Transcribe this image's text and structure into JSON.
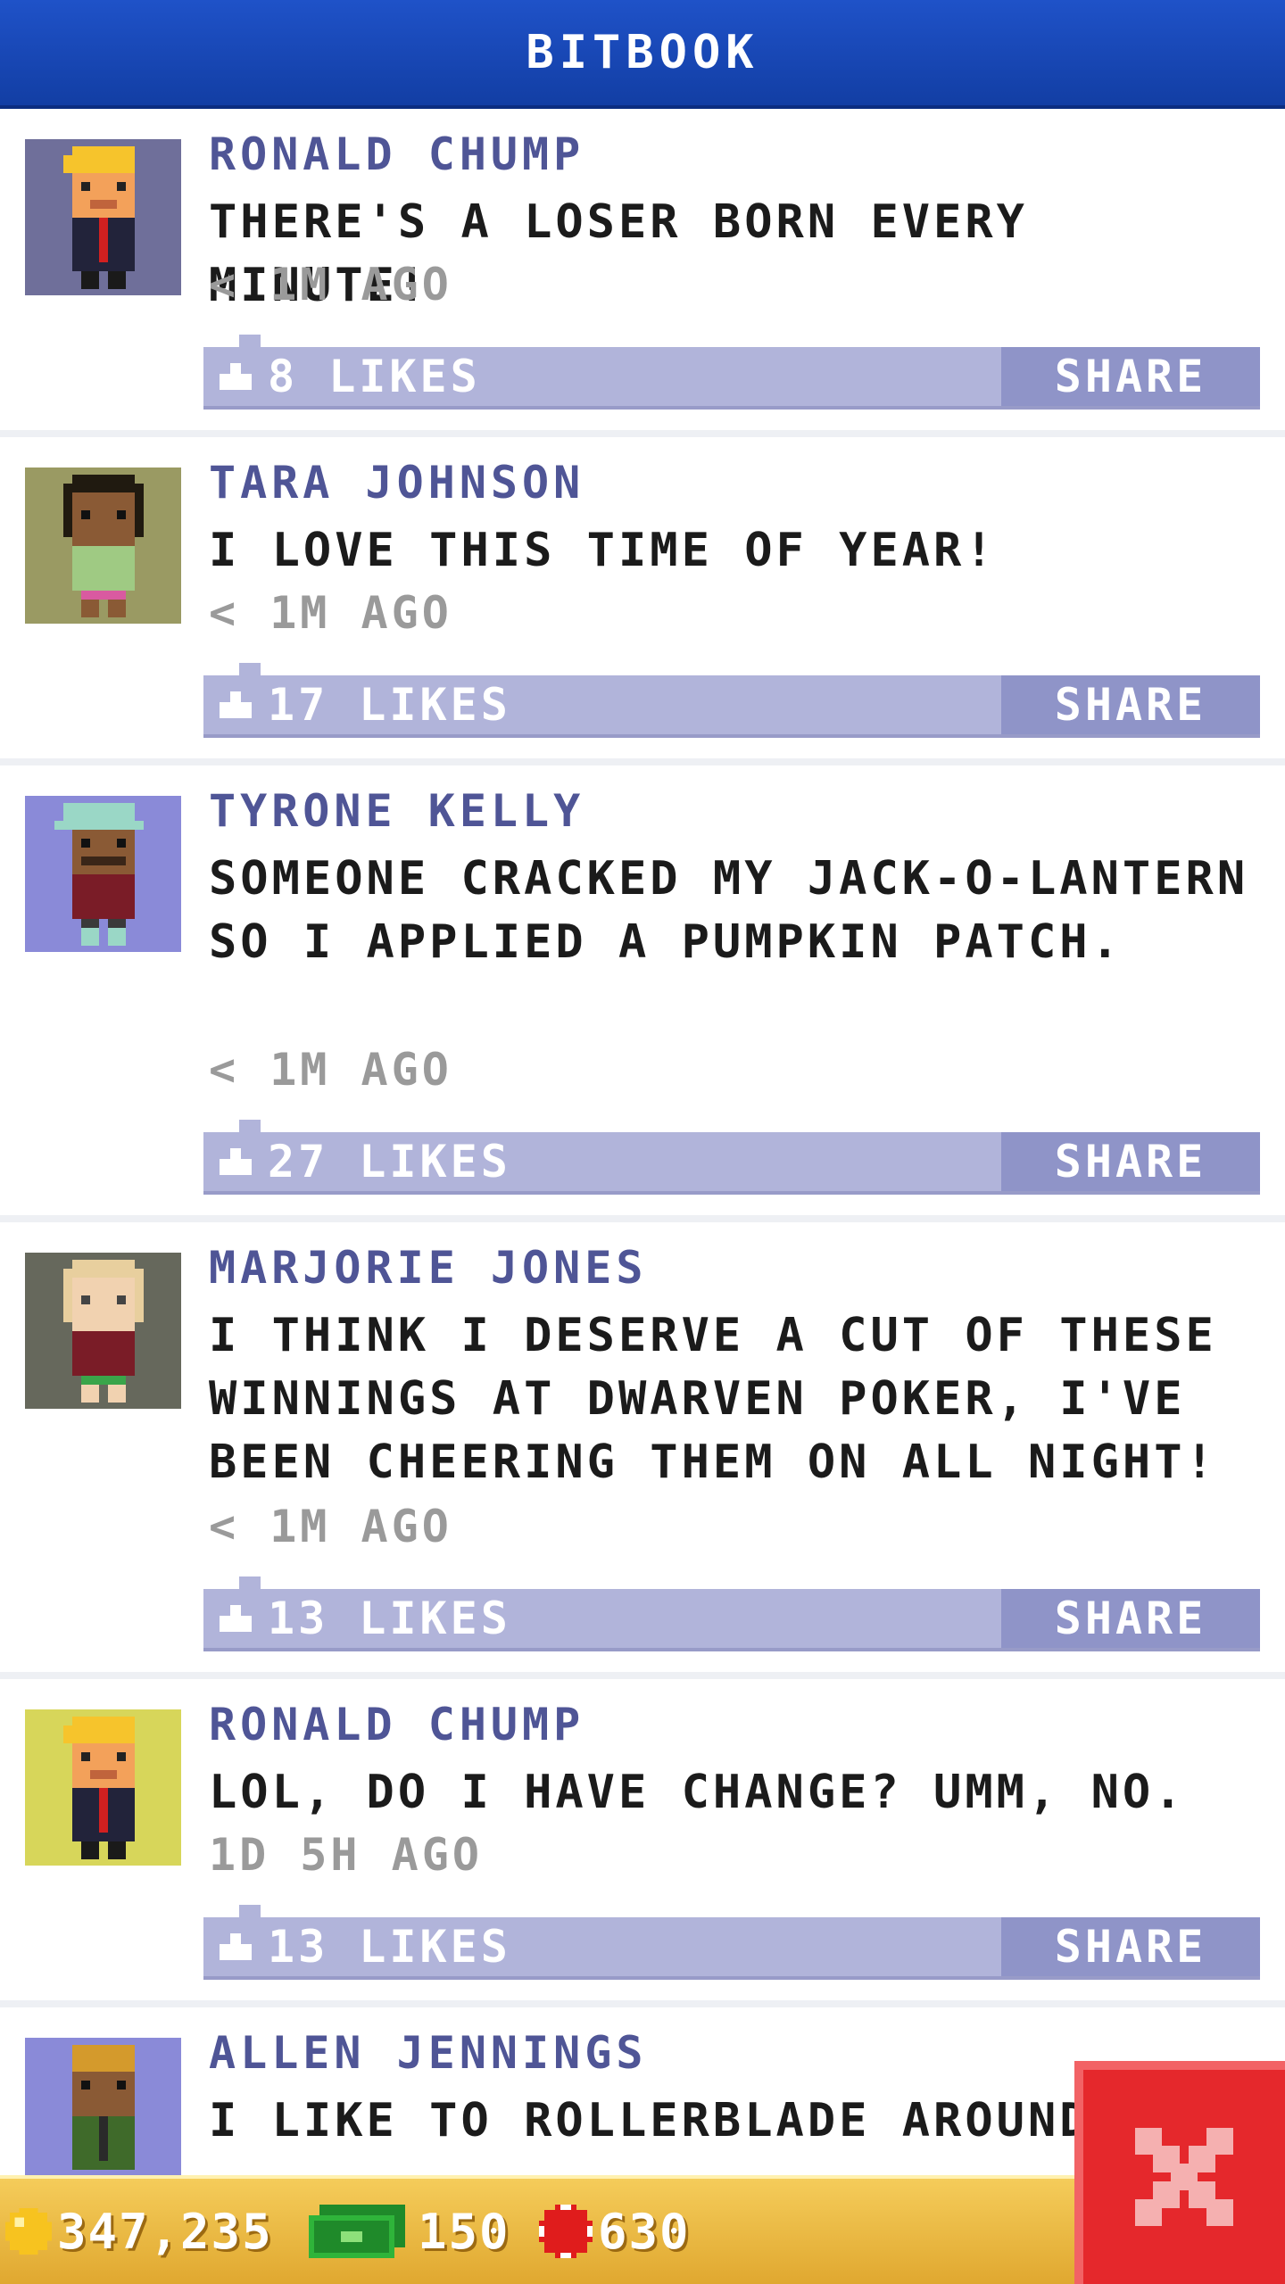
{
  "header": {
    "title": "BITBOOK"
  },
  "posts": [
    {
      "author": "RONALD CHUMP",
      "message": "THERE'S A LOSER BORN EVERY MINUTE!",
      "time": "< 1M AGO",
      "likes": "8 LIKES",
      "share": "SHARE",
      "avatar": {
        "icon": "ronald-chump-avatar",
        "bg": "#6f6f9a",
        "hair": "#f6c42c",
        "skin": "#f3a15a",
        "shirt": "#22233a",
        "accent": "#d22020"
      }
    },
    {
      "author": "TARA JOHNSON",
      "message": "I LOVE THIS TIME OF YEAR!",
      "time": "< 1M AGO",
      "likes": "17 LIKES",
      "share": "SHARE",
      "avatar": {
        "icon": "tara-johnson-avatar",
        "bg": "#9a9a63",
        "hair": "#201a10",
        "skin": "#8a5a35",
        "shirt": "#9fca83",
        "accent": "#d95aa0"
      }
    },
    {
      "author": "TYRONE KELLY",
      "message": "SOMEONE CRACKED MY JACK-O-LANTERN SO I APPLIED A PUMPKIN PATCH.",
      "time": "< 1M AGO",
      "likes": "27 LIKES",
      "share": "SHARE",
      "avatar": {
        "icon": "tyrone-kelly-avatar",
        "bg": "#8a8ad8",
        "hair": "#9ad7c6",
        "skin": "#8a5a35",
        "shirt": "#7a1c27",
        "accent": "#3a2618"
      }
    },
    {
      "author": "MARJORIE JONES",
      "message": "I THINK I DESERVE A CUT OF THESE WINNINGS AT DWARVEN POKER, I'VE BEEN CHEERING THEM ON ALL NIGHT!",
      "time": "< 1M AGO",
      "likes": "13 LIKES",
      "share": "SHARE",
      "avatar": {
        "icon": "marjorie-jones-avatar",
        "bg": "#66685c",
        "hair": "#e8cf9e",
        "skin": "#f1d2b0",
        "shirt": "#7a1c27",
        "accent": "#3aa54a"
      }
    },
    {
      "author": "RONALD CHUMP",
      "message": "LOL, DO I HAVE CHANGE? UMM, NO.",
      "time": "1D 5H AGO",
      "likes": "13 LIKES",
      "share": "SHARE",
      "avatar": {
        "icon": "ronald-chump-avatar",
        "bg": "#d7d65a",
        "hair": "#f6c42c",
        "skin": "#f3a15a",
        "shirt": "#22233a",
        "accent": "#d22020"
      }
    },
    {
      "author": "ALLEN JENNINGS",
      "message": "I LIKE TO ROLLERBLADE AROUND",
      "time": "",
      "likes": "",
      "share": "",
      "avatar": {
        "icon": "allen-jennings-avatar",
        "bg": "#8a8ad8",
        "hair": "#d49a2c",
        "skin": "#8a5a35",
        "shirt": "#3f6a2a",
        "accent": "#2a2a2a"
      }
    }
  ],
  "bottom_bar": {
    "coins": "347,235",
    "cash": "150",
    "chips": "630"
  },
  "colors": {
    "header_blue": "#1a4ab8",
    "like_bar": "#b1b4da",
    "share_button": "#8f94c8",
    "author_text": "#4f5596",
    "close_button": "#e5282c",
    "bottom_bar": "#eab640"
  },
  "icons": {
    "like": "thumbs-up-icon",
    "coin": "coin-icon",
    "cash": "cash-icon",
    "chip": "poker-chip-icon",
    "close": "close-icon"
  }
}
